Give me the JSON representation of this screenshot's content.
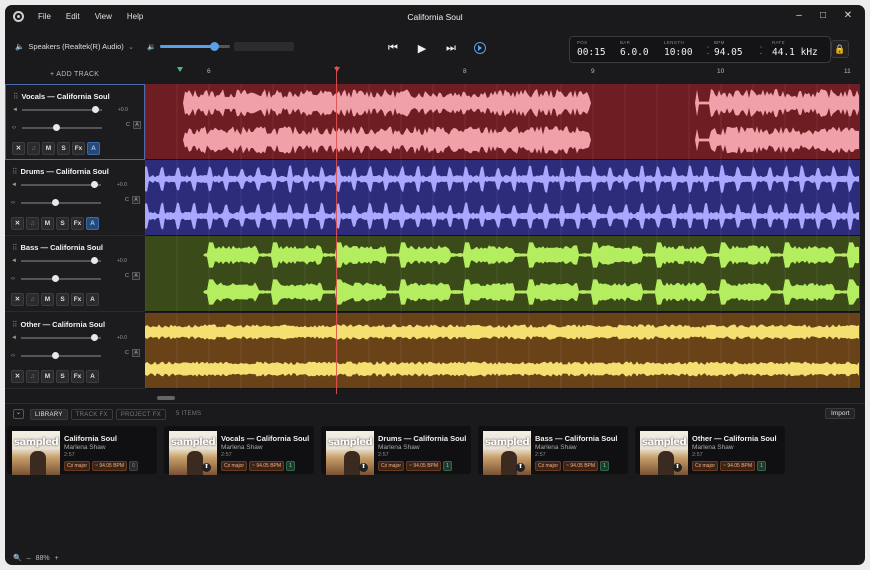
{
  "window": {
    "title": "California Soul"
  },
  "menu": [
    "File",
    "Edit",
    "View",
    "Help"
  ],
  "output_device": "Speakers (Realtek(R) Audio)",
  "master_volume_level": 0.78,
  "transport_display": {
    "pos_label": "POS",
    "pos": "00:15",
    "bar_label": "BAR",
    "bar": "6.0.0",
    "length_label": "LENGTH",
    "length": "10:00",
    "bpm_label": "BPM",
    "bpm": "94.05",
    "rate_label": "RATE",
    "rate": "44.1 kHz"
  },
  "add_track_label": "+ ADD TRACK",
  "ruler": {
    "ticks": [
      "6",
      "8",
      "9",
      "10",
      "11"
    ]
  },
  "tracks": [
    {
      "name": "Vocals — California Soul",
      "color": "#6e1d22",
      "wave": "#f0a0a8",
      "volume": "+0.0",
      "pan": "C",
      "automation_on": true
    },
    {
      "name": "Drums — California Soul",
      "color": "#2d2c7a",
      "wave": "#a8a8ff",
      "volume": "+0.0",
      "pan": "C",
      "automation_on": true
    },
    {
      "name": "Bass — California Soul",
      "color": "#3a4a18",
      "wave": "#b4ee60",
      "volume": "+0.0",
      "pan": "C",
      "automation_on": false
    },
    {
      "name": "Other — California Soul",
      "color": "#6a4218",
      "wave": "#f4e070",
      "volume": "+0.0",
      "pan": "C",
      "automation_on": false
    }
  ],
  "track_buttons": {
    "mute": "M",
    "solo": "S",
    "fx": "Fx",
    "auto": "A"
  },
  "library": {
    "tabs": [
      "LIBRARY",
      "TRACK FX",
      "PROJECT FX"
    ],
    "count": "5 ITEMS",
    "import_label": "Import",
    "items": [
      {
        "title": "California Soul",
        "artist": "Marlena Shaw",
        "duration": "2:57",
        "key": "C♯ major",
        "bpm": "~ 94.05 BPM",
        "badge": "0",
        "thumb_text": "sampled"
      },
      {
        "title": "Vocals — California Soul",
        "artist": "Marlena Shaw",
        "duration": "2:57",
        "key": "C♯ major",
        "bpm": "~ 94.05 BPM",
        "badge": "1",
        "thumb_text": "sampled"
      },
      {
        "title": "Drums — California Soul",
        "artist": "Marlena Shaw",
        "duration": "2:57",
        "key": "C♯ major",
        "bpm": "~ 94.05 BPM",
        "badge": "1",
        "thumb_text": "sampled"
      },
      {
        "title": "Bass — California Soul",
        "artist": "Marlena Shaw",
        "duration": "2:57",
        "key": "C♯ major",
        "bpm": "~ 94.05 BPM",
        "badge": "1",
        "thumb_text": "sampled"
      },
      {
        "title": "Other — California Soul",
        "artist": "Marlena Shaw",
        "duration": "2:57",
        "key": "C♯ major",
        "bpm": "~ 94.05 BPM",
        "badge": "1",
        "thumb_text": "sampled"
      }
    ]
  },
  "status": {
    "zoom": "88%",
    "minus": "–",
    "plus": "+"
  }
}
